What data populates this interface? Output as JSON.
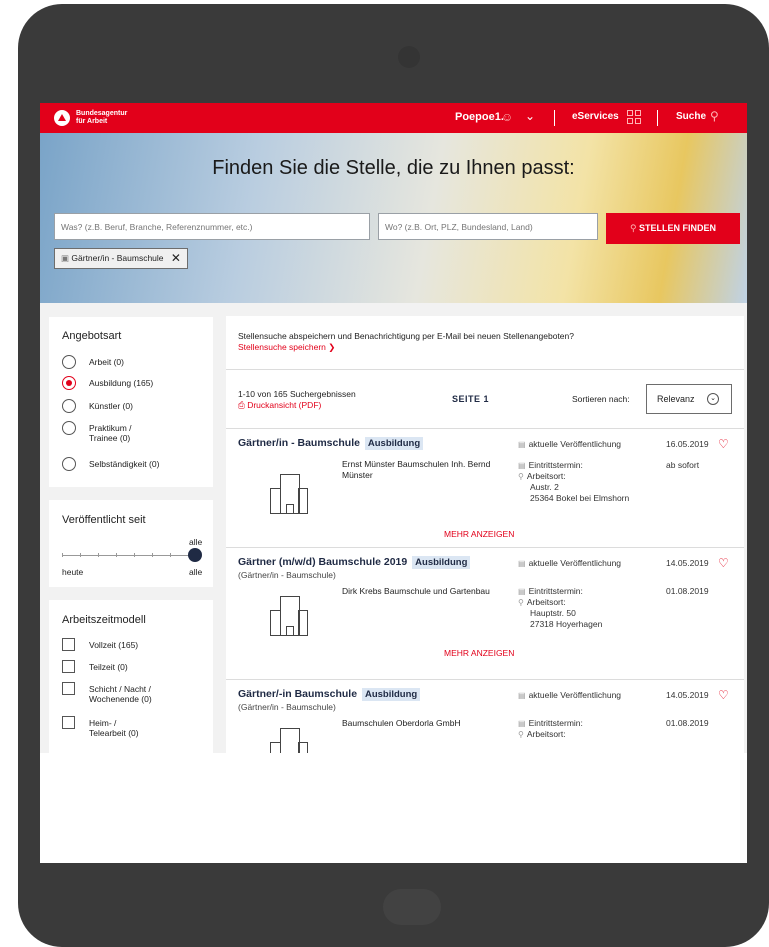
{
  "header": {
    "brand_line1": "Bundesagentur",
    "brand_line2": "für Arbeit",
    "user": "Poepoe1.",
    "eservices": "eServices",
    "suche": "Suche"
  },
  "hero": {
    "title": "Finden Sie die Stelle, die zu Ihnen passt:",
    "what_placeholder": "Was? (z.B. Beruf, Branche, Referenznummer, etc.)",
    "where_placeholder": "Wo? (z.B. Ort, PLZ, Bundesland, Land)",
    "button": "STELLEN FINDEN",
    "chip": "Gärtner/in - Baumschule"
  },
  "filters": {
    "angebotsart": {
      "title": "Angebotsart",
      "options": [
        {
          "label": "Arbeit (0)",
          "selected": false
        },
        {
          "label": "Ausbildung (165)",
          "selected": true
        },
        {
          "label": "Künstler (0)",
          "selected": false
        },
        {
          "label": "Praktikum / Trainee (0)",
          "selected": false
        },
        {
          "label": "Selbständigkeit (0)",
          "selected": false
        }
      ]
    },
    "veroeffentlicht": {
      "title": "Veröffentlicht seit",
      "value_label": "alle",
      "min_label": "heute",
      "max_label": "alle"
    },
    "arbeitszeit": {
      "title": "Arbeitszeitmodell",
      "options": [
        {
          "label": "Vollzeit (165)"
        },
        {
          "label": "Teilzeit (0)"
        },
        {
          "label": "Schicht / Nacht / Wochenende (0)"
        },
        {
          "label": "Heim- / Telearbeit (0)"
        }
      ]
    }
  },
  "results": {
    "notice": "Stellensuche abspeichern und Benachrichtigung per E-Mail bei neuen Stellenangeboten?",
    "notice_link": "Stellensuche speichern",
    "count": "1-10 von 165 Suchergebnissen",
    "pdf": "Druckansicht (PDF)",
    "page": "SEITE 1",
    "sort_label": "Sortieren nach:",
    "sort_value": "Relevanz",
    "more_label": "MEHR ANZEIGEN",
    "pub_label": "aktuelle Veröffentlichung",
    "start_label": "Eintrittstermin:",
    "place_label": "Arbeitsort:",
    "jobs": [
      {
        "title": "Gärtner/in - Baumschule",
        "badge": "Ausbildung",
        "subtitle": "",
        "date": "16.05.2019",
        "employer": "Ernst Münster Baumschulen Inh. Bernd Münster",
        "start": "ab sofort",
        "street": "Austr. 2",
        "city": "25364 Bokel bei Elmshorn"
      },
      {
        "title": "Gärtner (m/w/d) Baumschule 2019",
        "badge": "Ausbildung",
        "subtitle": "(Gärtner/in - Baumschule)",
        "date": "14.05.2019",
        "employer": "Dirk Krebs Baumschule und Gartenbau",
        "start": "01.08.2019",
        "street": "Hauptstr. 50",
        "city": "27318 Hoyerhagen"
      },
      {
        "title": "Gärtner/-in Baumschule",
        "badge": "Ausbildung",
        "subtitle": "(Gärtner/in - Baumschule)",
        "date": "14.05.2019",
        "employer": "Baumschulen Oberdorla GmbH",
        "start": "01.08.2019",
        "street": "",
        "city": ""
      }
    ]
  }
}
